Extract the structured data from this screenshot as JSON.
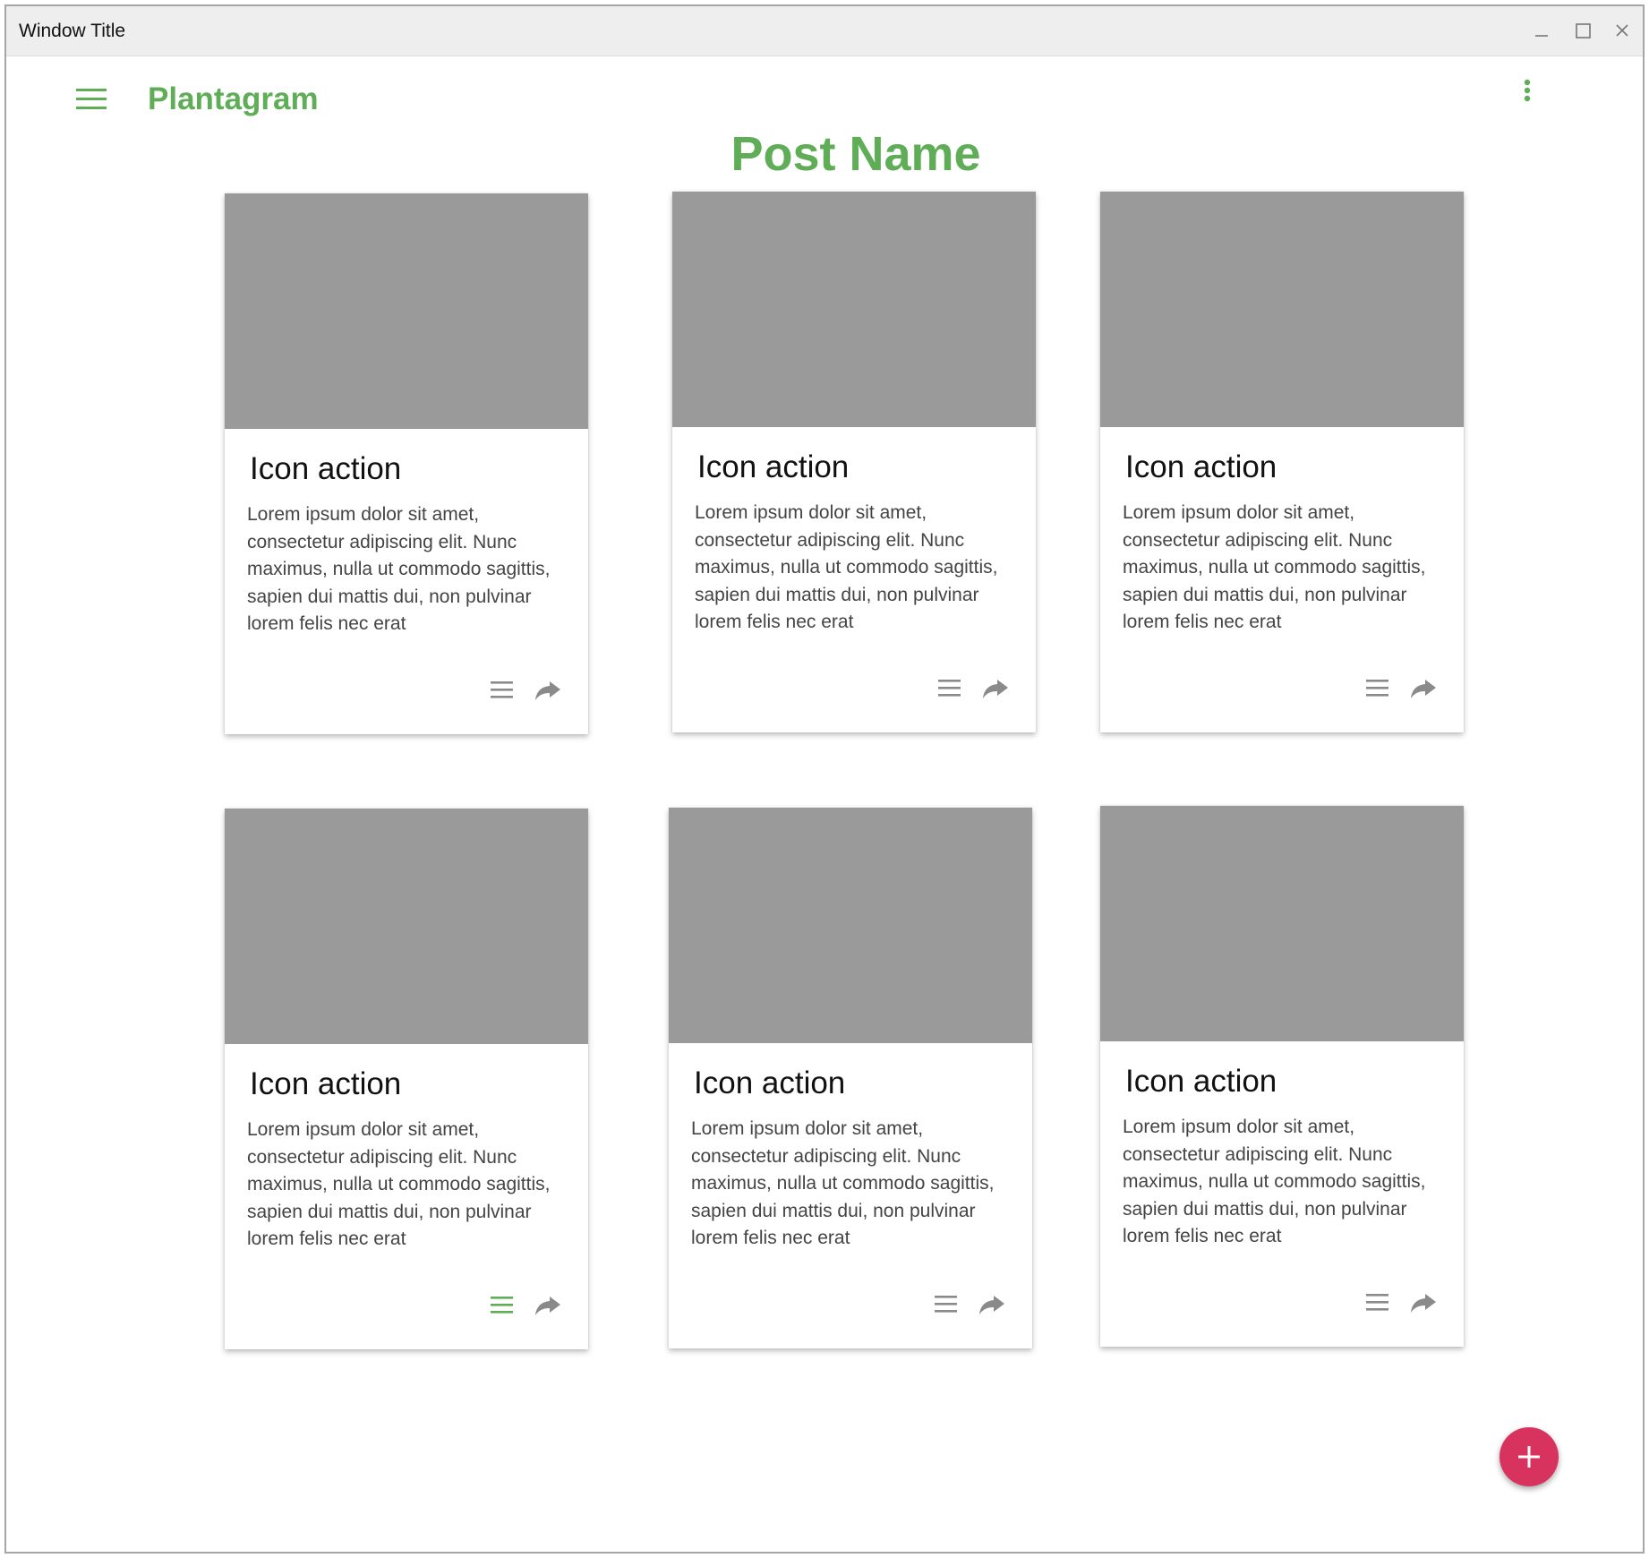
{
  "window": {
    "title": "Window Title",
    "controls": [
      "minimize-icon",
      "maximize-icon",
      "close-icon"
    ]
  },
  "appbar": {
    "app_name": "Plantagram",
    "menu_icon": "hamburger-menu-icon",
    "overflow_icon": "more-vert-icon"
  },
  "page": {
    "title": "Post Name"
  },
  "colors": {
    "accent": "#5fad56",
    "fab": "#d8325e",
    "media_placeholder": "#9a9a9a",
    "icon_default": "#8a8a8a"
  },
  "cards": [
    {
      "title": "Icon action",
      "text": "Lorem ipsum dolor sit amet, consectetur adipiscing elit. Nunc maximus, nulla ut commodo sagittis, sapien dui mattis dui, non pulvinar lorem felis nec erat",
      "actions": [
        "list-icon",
        "share-icon"
      ],
      "list_active": false
    },
    {
      "title": "Icon action",
      "text": "Lorem ipsum dolor sit amet, consectetur adipiscing elit. Nunc maximus, nulla ut commodo sagittis, sapien dui mattis dui, non pulvinar lorem felis nec erat",
      "actions": [
        "list-icon",
        "share-icon"
      ],
      "list_active": false
    },
    {
      "title": "Icon action",
      "text": "Lorem ipsum dolor sit amet, consectetur adipiscing elit. Nunc maximus, nulla ut commodo sagittis, sapien dui mattis dui, non pulvinar lorem felis nec erat",
      "actions": [
        "list-icon",
        "share-icon"
      ],
      "list_active": false
    },
    {
      "title": "Icon action",
      "text": "Lorem ipsum dolor sit amet, consectetur adipiscing elit. Nunc maximus, nulla ut commodo sagittis, sapien dui mattis dui, non pulvinar lorem felis nec erat",
      "actions": [
        "list-icon",
        "share-icon"
      ],
      "list_active": true
    },
    {
      "title": "Icon action",
      "text": "Lorem ipsum dolor sit amet, consectetur adipiscing elit. Nunc maximus, nulla ut commodo sagittis, sapien dui mattis dui, non pulvinar lorem felis nec erat",
      "actions": [
        "list-icon",
        "share-icon"
      ],
      "list_active": false
    },
    {
      "title": "Icon action",
      "text": "Lorem ipsum dolor sit amet, consectetur adipiscing elit. Nunc maximus, nulla ut commodo sagittis, sapien dui mattis dui, non pulvinar lorem felis nec erat",
      "actions": [
        "list-icon",
        "share-icon"
      ],
      "list_active": false
    }
  ],
  "fab": {
    "icon": "plus-icon"
  }
}
